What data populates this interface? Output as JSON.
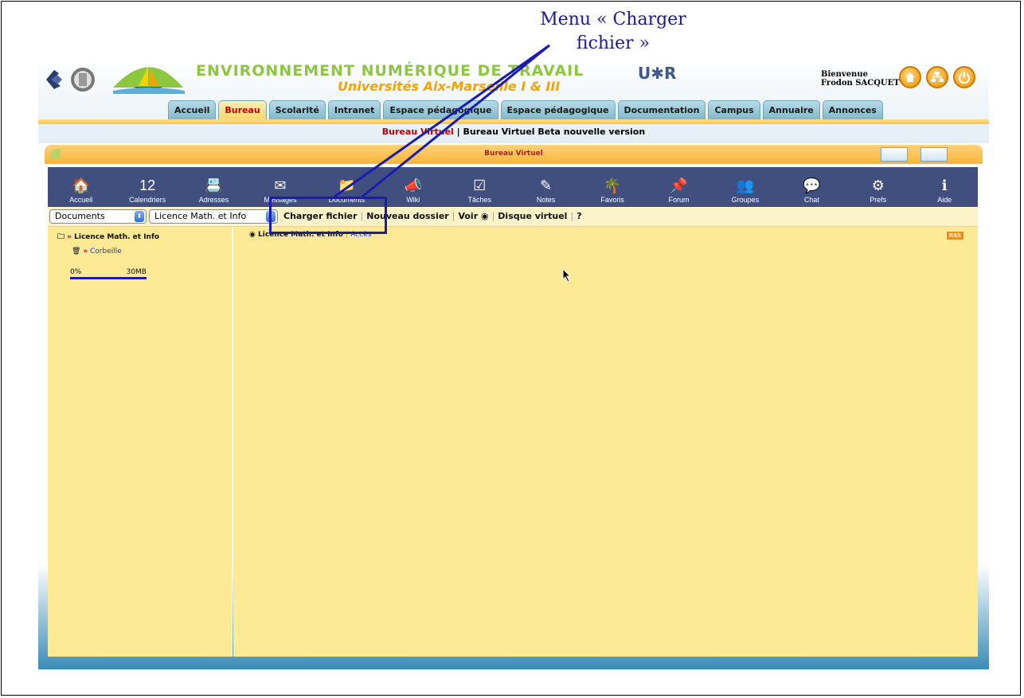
{
  "annotation": {
    "line1": "Menu « Charger",
    "line2": "fichier »"
  },
  "header": {
    "title": "ENVIRONNEMENT NUMÉRIQUE DE TRAVAIL",
    "subtitle": "Universités Aix-Marseille I & III",
    "partner_logo": "U✱R",
    "welcome": "Bienvenue",
    "user": "Frodon SACQUET",
    "icons": [
      "home-icon",
      "sitemap-icon",
      "power-icon"
    ]
  },
  "tabs": [
    {
      "label": "Accueil",
      "active": false
    },
    {
      "label": "Bureau",
      "active": true
    },
    {
      "label": "Scolarité",
      "active": false
    },
    {
      "label": "Intranet",
      "active": false
    },
    {
      "label": "Espace pédagogique",
      "active": false
    },
    {
      "label": "Espace pédagogique",
      "active": false
    },
    {
      "label": "Documentation",
      "active": false
    },
    {
      "label": "Campus",
      "active": false
    },
    {
      "label": "Annuaire",
      "active": false
    },
    {
      "label": "Annonces",
      "active": false
    }
  ],
  "subnav": {
    "current": "Bureau Virtuel",
    "separator": "|",
    "other": "Bureau Virtuel Beta nouvelle version"
  },
  "panel": {
    "title": "Bureau Virtuel"
  },
  "toolbar": [
    {
      "label": "Accueil",
      "icon": "home-icon",
      "glyph": "🏠"
    },
    {
      "label": "Calendriers",
      "icon": "calendar-icon",
      "glyph": "12"
    },
    {
      "label": "Adresses",
      "icon": "address-book-icon",
      "glyph": "📇"
    },
    {
      "label": "Messages",
      "icon": "envelope-icon",
      "glyph": "✉"
    },
    {
      "label": "Documents",
      "icon": "folder-icon",
      "glyph": "📁"
    },
    {
      "label": "Wiki",
      "icon": "megaphone-icon",
      "glyph": "📣"
    },
    {
      "label": "Tâches",
      "icon": "checklist-icon",
      "glyph": "☑"
    },
    {
      "label": "Notes",
      "icon": "notepad-icon",
      "glyph": "✎"
    },
    {
      "label": "Favoris",
      "icon": "palm-tree-icon",
      "glyph": "🌴"
    },
    {
      "label": "Forum",
      "icon": "pin-note-icon",
      "glyph": "📌"
    },
    {
      "label": "Groupes",
      "icon": "users-icon",
      "glyph": "👥"
    },
    {
      "label": "Chat",
      "icon": "chat-bubble-icon",
      "glyph": "💬"
    },
    {
      "label": "Prefs",
      "icon": "gears-icon",
      "glyph": "⚙"
    },
    {
      "label": "Aide",
      "icon": "info-icon",
      "glyph": "ℹ"
    }
  ],
  "selectors": {
    "module": "Documents",
    "space": "Licence Math. et Info"
  },
  "actions": {
    "upload": "Charger fichier",
    "new_folder": "Nouveau dossier",
    "view": "Voir",
    "virtual_disk": "Disque virtuel",
    "help": "?"
  },
  "tree": {
    "root": "Licence Math. et Info",
    "trash": "Corbeille",
    "marker": "»"
  },
  "quota": {
    "used": "0%",
    "total": "30MB"
  },
  "main": {
    "folder": "Licence Math. et Info",
    "access_link": "Accès",
    "rss": "RSS"
  }
}
